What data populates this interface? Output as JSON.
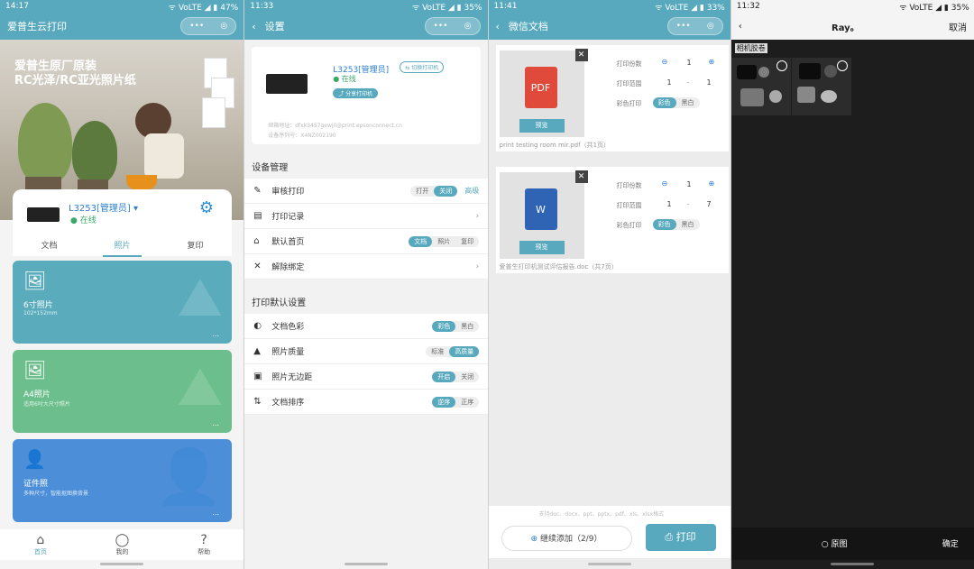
{
  "p1": {
    "time": "14:17",
    "battery": "47%",
    "title": "爱普生云打印",
    "capsule": [
      "•••",
      "◎"
    ],
    "hero": {
      "line1": "爱普生原厂原装",
      "line2": "RC光泽/RC亚光照片纸"
    },
    "device": {
      "name": "L3253[管理员] ▾",
      "status": "在线"
    },
    "tabs": [
      "文档",
      "照片",
      "复印"
    ],
    "cards": [
      {
        "name": "6寸照片",
        "sub": "102*152mm",
        "icon": "image-icon",
        "color": "#5aacbd"
      },
      {
        "name": "A4照片",
        "sub": "适用6吋大尺寸照片",
        "icon": "photo-icon",
        "color": "#6cbf8c"
      },
      {
        "name": "证件照",
        "sub": "多种尺寸，智能抠图换背景",
        "icon": "id-photo-icon",
        "color": "#4c8fd8"
      }
    ],
    "dots": "...",
    "tabbar": [
      {
        "label": "首页",
        "icon": "⌂"
      },
      {
        "label": "我的",
        "icon": "◯"
      },
      {
        "label": "帮助",
        "icon": "?"
      }
    ]
  },
  "p2": {
    "time": "11:33",
    "battery": "35%",
    "title": "设置",
    "device": {
      "name": "L3253[管理员]",
      "switch": "切换打印机",
      "status": "在线",
      "share": "分享打印机",
      "email": "邮箱地址：dfxk3457gewjil@print.epsonconnect.cn",
      "code": "设备序列号：X4NZ002190"
    },
    "sec1": "设备管理",
    "items1": [
      {
        "label": "审核打印",
        "seg": [
          "打开",
          "关闭"
        ],
        "active": 1,
        "extra": "高级",
        "icon": "✎"
      },
      {
        "label": "打印记录",
        "icon": "▤"
      },
      {
        "label": "默认首页",
        "seg": [
          "文档",
          "照片",
          "复印"
        ],
        "active": 0,
        "icon": "⌂"
      },
      {
        "label": "解除绑定",
        "icon": "✕"
      }
    ],
    "sec2": "打印默认设置",
    "items2": [
      {
        "label": "文档色彩",
        "seg": [
          "彩色",
          "黑白"
        ],
        "active": 0,
        "icon": "◐"
      },
      {
        "label": "照片质量",
        "seg": [
          "标准",
          "高质量"
        ],
        "active": 1,
        "icon": "▲"
      },
      {
        "label": "照片无边距",
        "seg": [
          "开启",
          "关闭"
        ],
        "active": 0,
        "icon": "▣"
      },
      {
        "label": "文档排序",
        "seg": [
          "逆序",
          "正序"
        ],
        "active": 0,
        "icon": "⇅"
      }
    ]
  },
  "p3": {
    "time": "11:41",
    "battery": "33%",
    "title": "微信文档",
    "files": [
      {
        "type": "PDF",
        "color": "#e04a3a",
        "name": "print testing room mir.pdf（共1页）",
        "copies": "1",
        "range_from": "1",
        "range_to": "1"
      },
      {
        "type": "W",
        "color": "#2f63b3",
        "name": "爱普生打印机测试评估报告.doc（共7页）",
        "copies": "1",
        "range_from": "1",
        "range_to": "7"
      }
    ],
    "labels": {
      "copies": "打印份数",
      "range": "打印范围",
      "color": "彩色打印",
      "preview": "预览",
      "c1": "彩色",
      "c2": "黑白"
    },
    "hint": "支持doc、docx、ppt、pptx、pdf、xls、xlsx格式",
    "add": "继续添加（2/9）",
    "print": "打印"
  },
  "p4": {
    "time": "11:32",
    "battery": "35%",
    "title": "Ray。",
    "cancel": "取消",
    "album": "相机胶卷",
    "original": "原图",
    "confirm": "确定"
  }
}
